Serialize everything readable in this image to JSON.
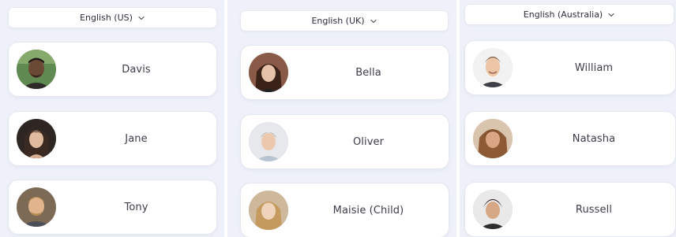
{
  "columns": [
    {
      "language": "English (US)",
      "voices": [
        {
          "name": "Davis",
          "avatar": "avatar-davis"
        },
        {
          "name": "Jane",
          "avatar": "avatar-jane"
        },
        {
          "name": "Tony",
          "avatar": "avatar-tony"
        }
      ]
    },
    {
      "language": "English (UK)",
      "voices": [
        {
          "name": "Bella",
          "avatar": "avatar-bella"
        },
        {
          "name": "Oliver",
          "avatar": "avatar-oliver"
        },
        {
          "name": "Maisie (Child)",
          "avatar": "avatar-maisie"
        }
      ]
    },
    {
      "language": "English (Australia)",
      "voices": [
        {
          "name": "William",
          "avatar": "avatar-william"
        },
        {
          "name": "Natasha",
          "avatar": "avatar-natasha"
        },
        {
          "name": "Russell",
          "avatar": "avatar-russell"
        }
      ]
    }
  ],
  "icons": {
    "dropdown": "chevron-down-icon"
  },
  "colors": {
    "panel_background": "#eef1f9",
    "card_background": "#ffffff",
    "text": "#3d3d48"
  }
}
